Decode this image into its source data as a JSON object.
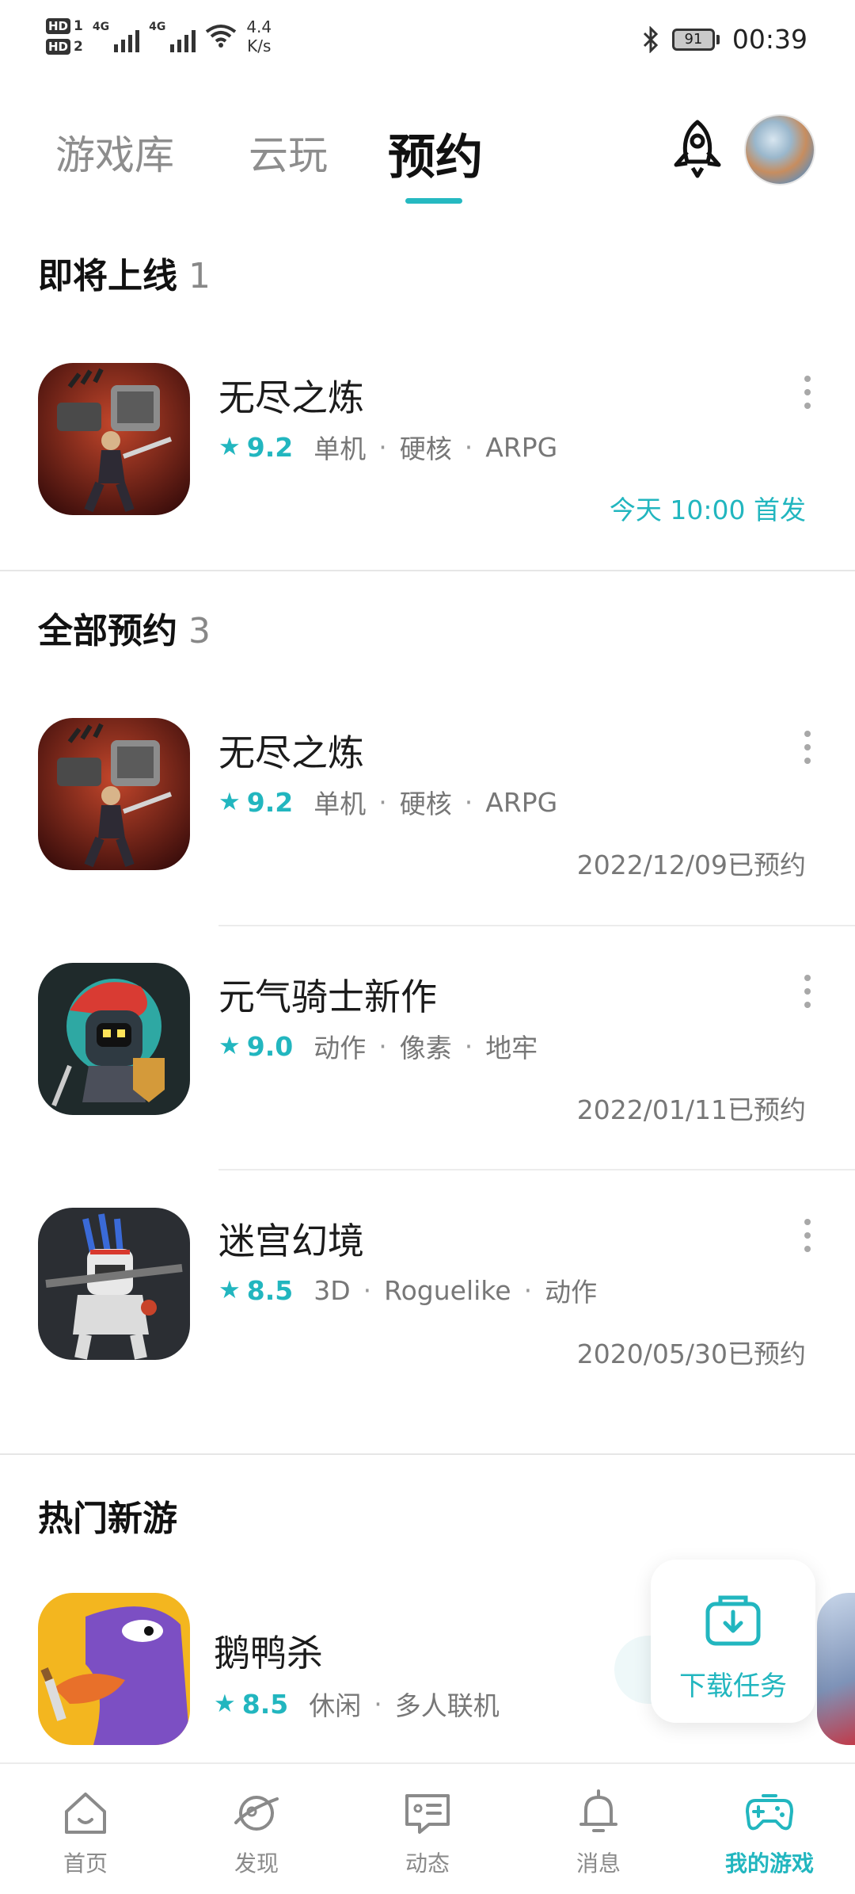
{
  "status_bar": {
    "hd1": "HD",
    "hd1_num": "1",
    "hd2": "HD",
    "hd2_num": "2",
    "net1": "4G",
    "net2": "4G",
    "speed_value": "4.4",
    "speed_unit": "K/s",
    "battery": "91",
    "time": "00:39"
  },
  "tabs": [
    {
      "label": "游戏库",
      "active": false
    },
    {
      "label": "云玩",
      "active": false
    },
    {
      "label": "预约",
      "active": true
    }
  ],
  "upcoming": {
    "title": "即将上线",
    "count": "1",
    "items": [
      {
        "name": "无尽之炼",
        "score": "9.2",
        "tags": [
          "单机",
          "硬核",
          "ARPG"
        ],
        "date": "今天 10:00 首发"
      }
    ]
  },
  "all_reservations": {
    "title": "全部预约",
    "count": "3",
    "items": [
      {
        "name": "无尽之炼",
        "score": "9.2",
        "tags": [
          "单机",
          "硬核",
          "ARPG"
        ],
        "date": "2022/12/09已预约"
      },
      {
        "name": "元气骑士新作",
        "score": "9.0",
        "tags": [
          "动作",
          "像素",
          "地牢"
        ],
        "date": "2022/01/11已预约"
      },
      {
        "name": "迷宫幻境",
        "score": "8.5",
        "tags": [
          "3D",
          "Roguelike",
          "动作"
        ],
        "date": "2020/05/30已预约"
      }
    ]
  },
  "hot_new": {
    "title": "热门新游",
    "items": [
      {
        "name": "鹅鸭杀",
        "score": "8.5",
        "tags": [
          "休闲",
          "多人联机"
        ]
      }
    ]
  },
  "download_task": {
    "label": "下载任务"
  },
  "bottom_nav": [
    {
      "label": "首页",
      "icon": "home-icon",
      "active": false
    },
    {
      "label": "发现",
      "icon": "planet-icon",
      "active": false
    },
    {
      "label": "动态",
      "icon": "message-card-icon",
      "active": false
    },
    {
      "label": "消息",
      "icon": "bell-icon",
      "active": false
    },
    {
      "label": "我的游戏",
      "icon": "gamepad-icon",
      "active": true
    }
  ],
  "colors": {
    "accent": "#22b6bf",
    "text": "#1b1b1b",
    "muted": "#777777"
  }
}
